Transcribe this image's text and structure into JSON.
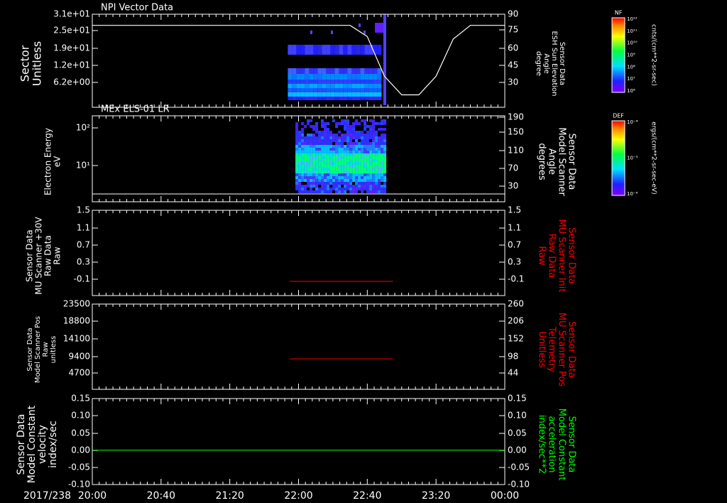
{
  "footer": {
    "date": "2017/238",
    "time_ticks": [
      "20:00",
      "20:40",
      "21:20",
      "22:00",
      "22:40",
      "23:20",
      "00:00"
    ]
  },
  "colors": {
    "background": "#000000",
    "axes": "#ffffff",
    "red_trace": "#ff0000",
    "green_trace": "#00ff00"
  },
  "colorbars": [
    {
      "label": "NF",
      "units": "cnts/(cm**2-sr-sec)",
      "ticks": [
        "10¹²",
        "10¹¹",
        "10¹⁰",
        "10⁹",
        "10⁸",
        "10⁷",
        "10⁶"
      ]
    },
    {
      "label": "DEF",
      "units": "ergs/(cm**2-sr-sec-eV)",
      "ticks": [
        "10⁻⁴",
        "10⁻⁵",
        "10⁻⁶"
      ]
    }
  ],
  "chart_data": [
    {
      "type": "heatmap",
      "title": "NPI Vector Data",
      "ylabel": [
        "Sector",
        "Unitless"
      ],
      "yticks": [
        "3.1e+01",
        "2.5e+01",
        "1.9e+01",
        "1.2e+01",
        "6.2e+00"
      ],
      "y2label": [
        "Sensor Data",
        "ESH Sun Elevation",
        "Angle",
        "degree"
      ],
      "y2ticks": [
        "90",
        "75",
        "60",
        "45",
        "30"
      ],
      "y2lim": [
        15,
        90
      ],
      "overlay_line": {
        "name": "ESH Sun Elevation Angle",
        "x": [
          "20:00",
          "22:30",
          "22:40",
          "22:50",
          "23:00",
          "23:10",
          "23:20",
          "23:30",
          "23:40",
          "23:50",
          "00:00"
        ],
        "y": [
          81,
          81,
          72,
          40,
          25,
          25,
          40,
          70,
          81,
          81,
          81
        ]
      }
    },
    {
      "type": "heatmap",
      "title": "MEx ELS-01 LR",
      "ylabel": [
        "Electron Energy",
        "eV"
      ],
      "yticks": [
        "10²",
        "10¹"
      ],
      "y2label": [
        "Sensor Data",
        "Model Scanner",
        "Angle",
        "degrees"
      ],
      "y2ticks": [
        "190",
        "150",
        "110",
        "70",
        "30"
      ],
      "y2lim": [
        0,
        190
      ]
    },
    {
      "type": "line",
      "ylabel": [
        "Sensor Data",
        "MU Scanner +30V",
        "Raw Data",
        "Raw"
      ],
      "yticks": [
        "1.5",
        "1.1",
        "0.7",
        "0.3",
        "-0.1"
      ],
      "ylim": [
        -0.3,
        1.5
      ],
      "y2label": [
        "Sensor Data",
        "MU Scanner Init",
        "Raw Data",
        "Raw"
      ],
      "y2ticks": [
        "1.5",
        "1.1",
        "0.7",
        "0.3",
        "-0.1"
      ],
      "series": [
        {
          "x": [
            "21:55",
            "22:55"
          ],
          "y": [
            0.0,
            0.0
          ]
        }
      ]
    },
    {
      "type": "line",
      "ylabel": [
        "Sensor Data",
        "Model Scanner Pos",
        "Raw",
        "unitless"
      ],
      "yticks": [
        "23500",
        "18800",
        "14100",
        "9400",
        "4700"
      ],
      "ylim": [
        0,
        23500
      ],
      "y2label": [
        "Sensor Data",
        "MU Scanner Pos",
        "Telemetry",
        "Unitless"
      ],
      "y2ticks": [
        "260",
        "206",
        "152",
        "98",
        "44"
      ],
      "series": [
        {
          "x": [
            "21:55",
            "22:55"
          ],
          "y": [
            8400,
            8400
          ]
        }
      ]
    },
    {
      "type": "line",
      "ylabel": [
        "Sensor Data",
        "Model Constant",
        "velocity",
        "index/sec"
      ],
      "yticks": [
        "0.15",
        "0.10",
        "0.05",
        "0.00",
        "-0.05",
        "-0.10"
      ],
      "ylim": [
        -0.1,
        0.15
      ],
      "y2label": [
        "Sensor Data",
        "Model Constant",
        "acceleration",
        "index/sec**2"
      ],
      "y2ticks": [
        "0.15",
        "0.10",
        "0.05",
        "0.00",
        "-0.05",
        "-0.10"
      ],
      "series": [
        {
          "x": [
            "20:00",
            "00:00"
          ],
          "y": [
            0.0,
            0.0
          ]
        }
      ]
    }
  ]
}
